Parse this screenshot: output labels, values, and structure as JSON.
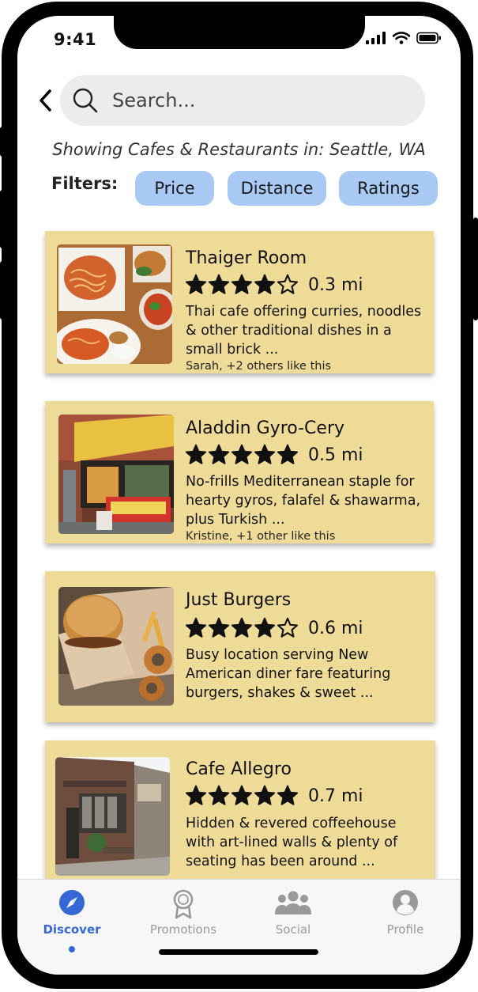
{
  "status": {
    "time": "9:41"
  },
  "search": {
    "placeholder": "Search..."
  },
  "location_text": "Showing Cafes & Restaurants in: Seattle, WA",
  "filters": {
    "label": "Filters:",
    "chips": [
      "Price",
      "Distance",
      "Ratings"
    ]
  },
  "restaurants": [
    {
      "name": "Thaiger Room",
      "rating": 4,
      "distance": "0.3 mi",
      "description": "Thai cafe offering curries, noodles & other traditional dishes in a small brick ...",
      "likes": "Sarah, +2 others like this",
      "image": "thai-food-image"
    },
    {
      "name": "Aladdin Gyro-Cery",
      "rating": 5,
      "distance": "0.5 mi",
      "description": "No-frills Mediterranean staple for hearty gyros, falafel & shawarma, plus Turkish ...",
      "likes": "Kristine, +1 other like this",
      "image": "deli-storefront-image"
    },
    {
      "name": "Just Burgers",
      "rating": 4,
      "distance": "0.6 mi",
      "description": "Busy location serving New American diner fare featuring burgers, shakes & sweet ...",
      "likes": "",
      "image": "burger-image"
    },
    {
      "name": "Cafe Allegro",
      "rating": 5,
      "distance": "0.7 mi",
      "description": "Hidden & revered coffeehouse with art-lined walls & plenty of seating has been around ...",
      "likes": "",
      "image": "cafe-alley-image"
    }
  ],
  "tabs": [
    {
      "label": "Discover",
      "icon": "compass-icon",
      "active": true
    },
    {
      "label": "Promotions",
      "icon": "award-ribbon-icon",
      "active": false
    },
    {
      "label": "Social",
      "icon": "group-icon",
      "active": false
    },
    {
      "label": "Profile",
      "icon": "user-icon",
      "active": false
    }
  ],
  "colors": {
    "card": "#efdb98",
    "chip": "#a9c9f5",
    "accent": "#3568d4",
    "inactive_tab": "#999999"
  }
}
